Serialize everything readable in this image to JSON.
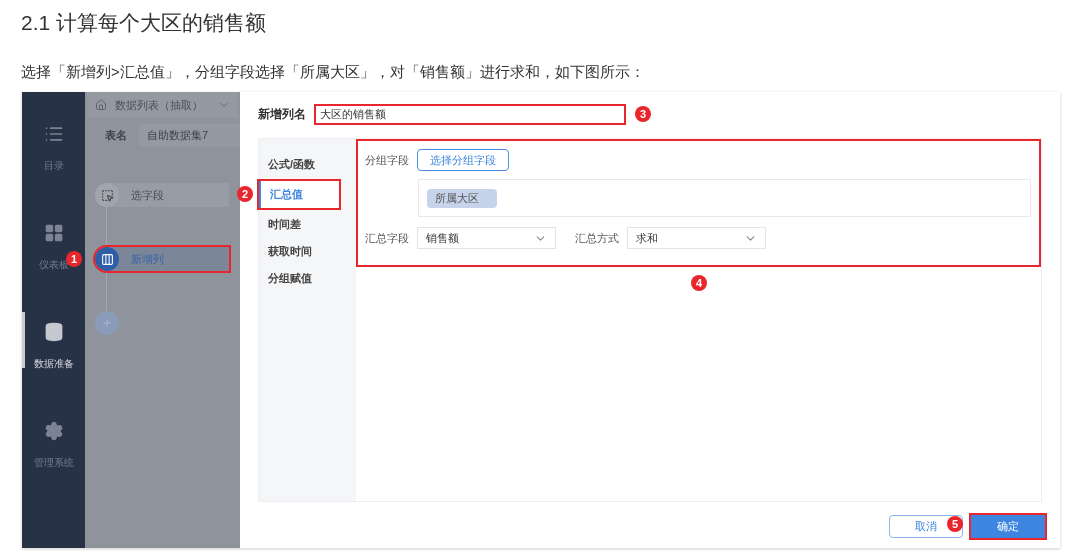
{
  "heading": "2.1 计算每个大区的销售额",
  "intro": "选择「新增列>汇总值」，分组字段选择「所属大区」，对「销售额」进行求和，如下图所示：",
  "sidebar": {
    "items": [
      {
        "label": "目录",
        "kind": "list",
        "selected": false
      },
      {
        "label": "仪表板",
        "kind": "grid",
        "selected": false
      },
      {
        "label": "数据准备",
        "kind": "database",
        "selected": true
      },
      {
        "label": "管理系统",
        "kind": "gear",
        "selected": false
      }
    ]
  },
  "dataset": {
    "source": "数据列表（抽取）",
    "table_label": "表名",
    "table_name": "自助数据集7",
    "steps": [
      {
        "label": "选字段",
        "kind": "fields",
        "selected": false
      },
      {
        "label": "新增列",
        "kind": "column",
        "selected": true,
        "marker": "1"
      }
    ]
  },
  "dialog": {
    "name_label": "新增列名",
    "name_value": "大区的销售额",
    "name_marker": "3",
    "methods": [
      {
        "label": "公式/函数",
        "selected": false
      },
      {
        "label": "汇总值",
        "selected": true,
        "marker": "2"
      },
      {
        "label": "时间差",
        "selected": false
      },
      {
        "label": "获取时间",
        "selected": false
      },
      {
        "label": "分组赋值",
        "selected": false
      }
    ],
    "group_label": "分组字段",
    "group_button": "选择分组字段",
    "group_chips": [
      "所属大区"
    ],
    "summary_field": {
      "label": "汇总字段",
      "value": "销售额"
    },
    "summary_method": {
      "label": "汇总方式",
      "value": "求和"
    },
    "section_marker": "4",
    "buttons": [
      {
        "label": "取消",
        "kind": "secondary"
      },
      {
        "label": "确定",
        "kind": "primary",
        "marker": "5"
      }
    ]
  }
}
